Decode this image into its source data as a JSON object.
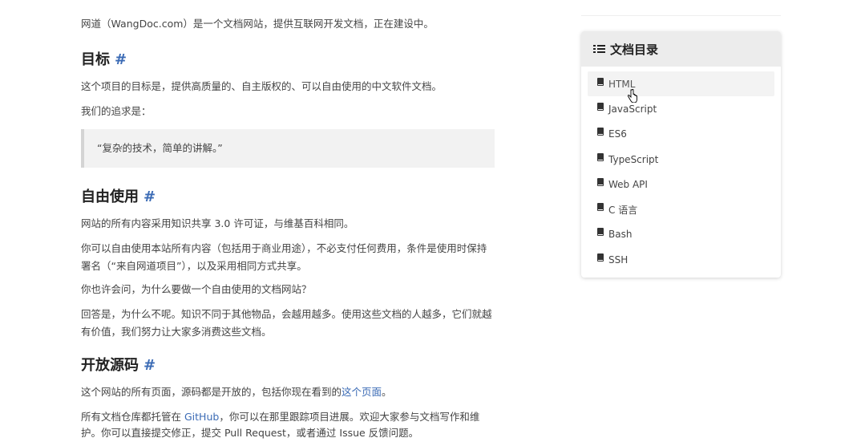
{
  "intro": {
    "text": "网道（WangDoc.com）是一个文档网站，提供互联网开发文档，正在建设中。"
  },
  "sections": {
    "goal": {
      "heading": "目标",
      "anchor": "#",
      "p1": "这个项目的目标是，提供高质量的、自主版权的、可以自由使用的中文软件文档。",
      "p2": "我们的追求是：",
      "quote": "“复杂的技术，简单的讲解。”"
    },
    "free": {
      "heading": "自由使用",
      "anchor": "#",
      "p1": "网站的所有内容采用知识共享 3.0 许可证，与维基百科相同。",
      "p2": "你可以自由使用本站所有内容（包括用于商业用途），不必支付任何费用，条件是使用时保持署名（“来自网道项目”），以及采用相同方式共享。",
      "p3": "你也许会问，为什么要做一个自由使用的文档网站？",
      "p4": "回答是，为什么不呢。知识不同于其他物品，会越用越多。使用这些文档的人越多，它们就越有价值，我们努力让大家多消费这些文档。"
    },
    "open": {
      "heading": "开放源码",
      "anchor": "#",
      "p1_pre": "这个网站的所有页面，源码都是开放的，包括你现在看到的",
      "p1_link": "这个页面",
      "p1_post": "。",
      "p2_pre": "所有文档仓库都托管在 ",
      "p2_link": "GitHub",
      "p2_post": "，你可以在那里跟踪项目进展。欢迎大家参与文档写作和维",
      "p3": "护。你可以直接提交修正，提交 Pull Request，或者通过 Issue 反馈问题。"
    }
  },
  "toc": {
    "title": "文档目录",
    "items": [
      {
        "label": "HTML"
      },
      {
        "label": "JavaScript"
      },
      {
        "label": "ES6"
      },
      {
        "label": "TypeScript"
      },
      {
        "label": "Web API"
      },
      {
        "label": "C 语言"
      },
      {
        "label": "Bash"
      },
      {
        "label": "SSH"
      }
    ]
  }
}
